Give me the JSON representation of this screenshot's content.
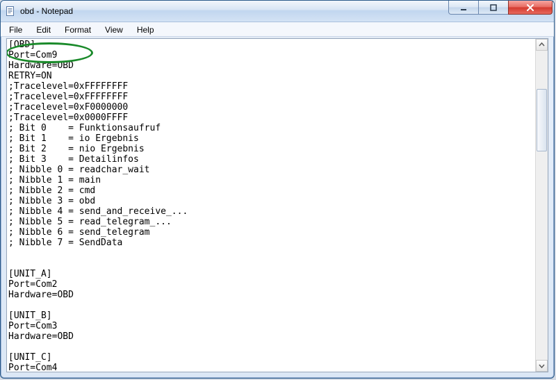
{
  "window": {
    "title": "obd - Notepad"
  },
  "menubar": {
    "file": "File",
    "edit": "Edit",
    "format": "Format",
    "view": "View",
    "help": "Help"
  },
  "editor": {
    "lines": [
      "[OBD]",
      "Port=Com9",
      "Hardware=OBD",
      "RETRY=ON",
      ";Tracelevel=0xFFFFFFFF",
      ";Tracelevel=0xFFFFFFFF",
      ";Tracelevel=0xF0000000",
      ";Tracelevel=0x0000FFFF",
      "; Bit 0    = Funktionsaufruf",
      "; Bit 1    = io Ergebnis",
      "; Bit 2    = nio Ergebnis",
      "; Bit 3    = Detailinfos",
      "; Nibble 0 = readchar_wait",
      "; Nibble 1 = main",
      "; Nibble 2 = cmd",
      "; Nibble 3 = obd",
      "; Nibble 4 = send_and_receive_...",
      "; Nibble 5 = read_telegram_...",
      "; Nibble 6 = send_telegram",
      "; Nibble 7 = SendData",
      "",
      "",
      "[UNIT_A]",
      "Port=Com2",
      "Hardware=OBD",
      "",
      "[UNIT_B]",
      "Port=Com3",
      "Hardware=OBD",
      "",
      "[UNIT_C]",
      "Port=Com4",
      "Hardware=OBD"
    ]
  },
  "annotation": {
    "target_line_index": 1,
    "color": "#1a8a2a"
  }
}
